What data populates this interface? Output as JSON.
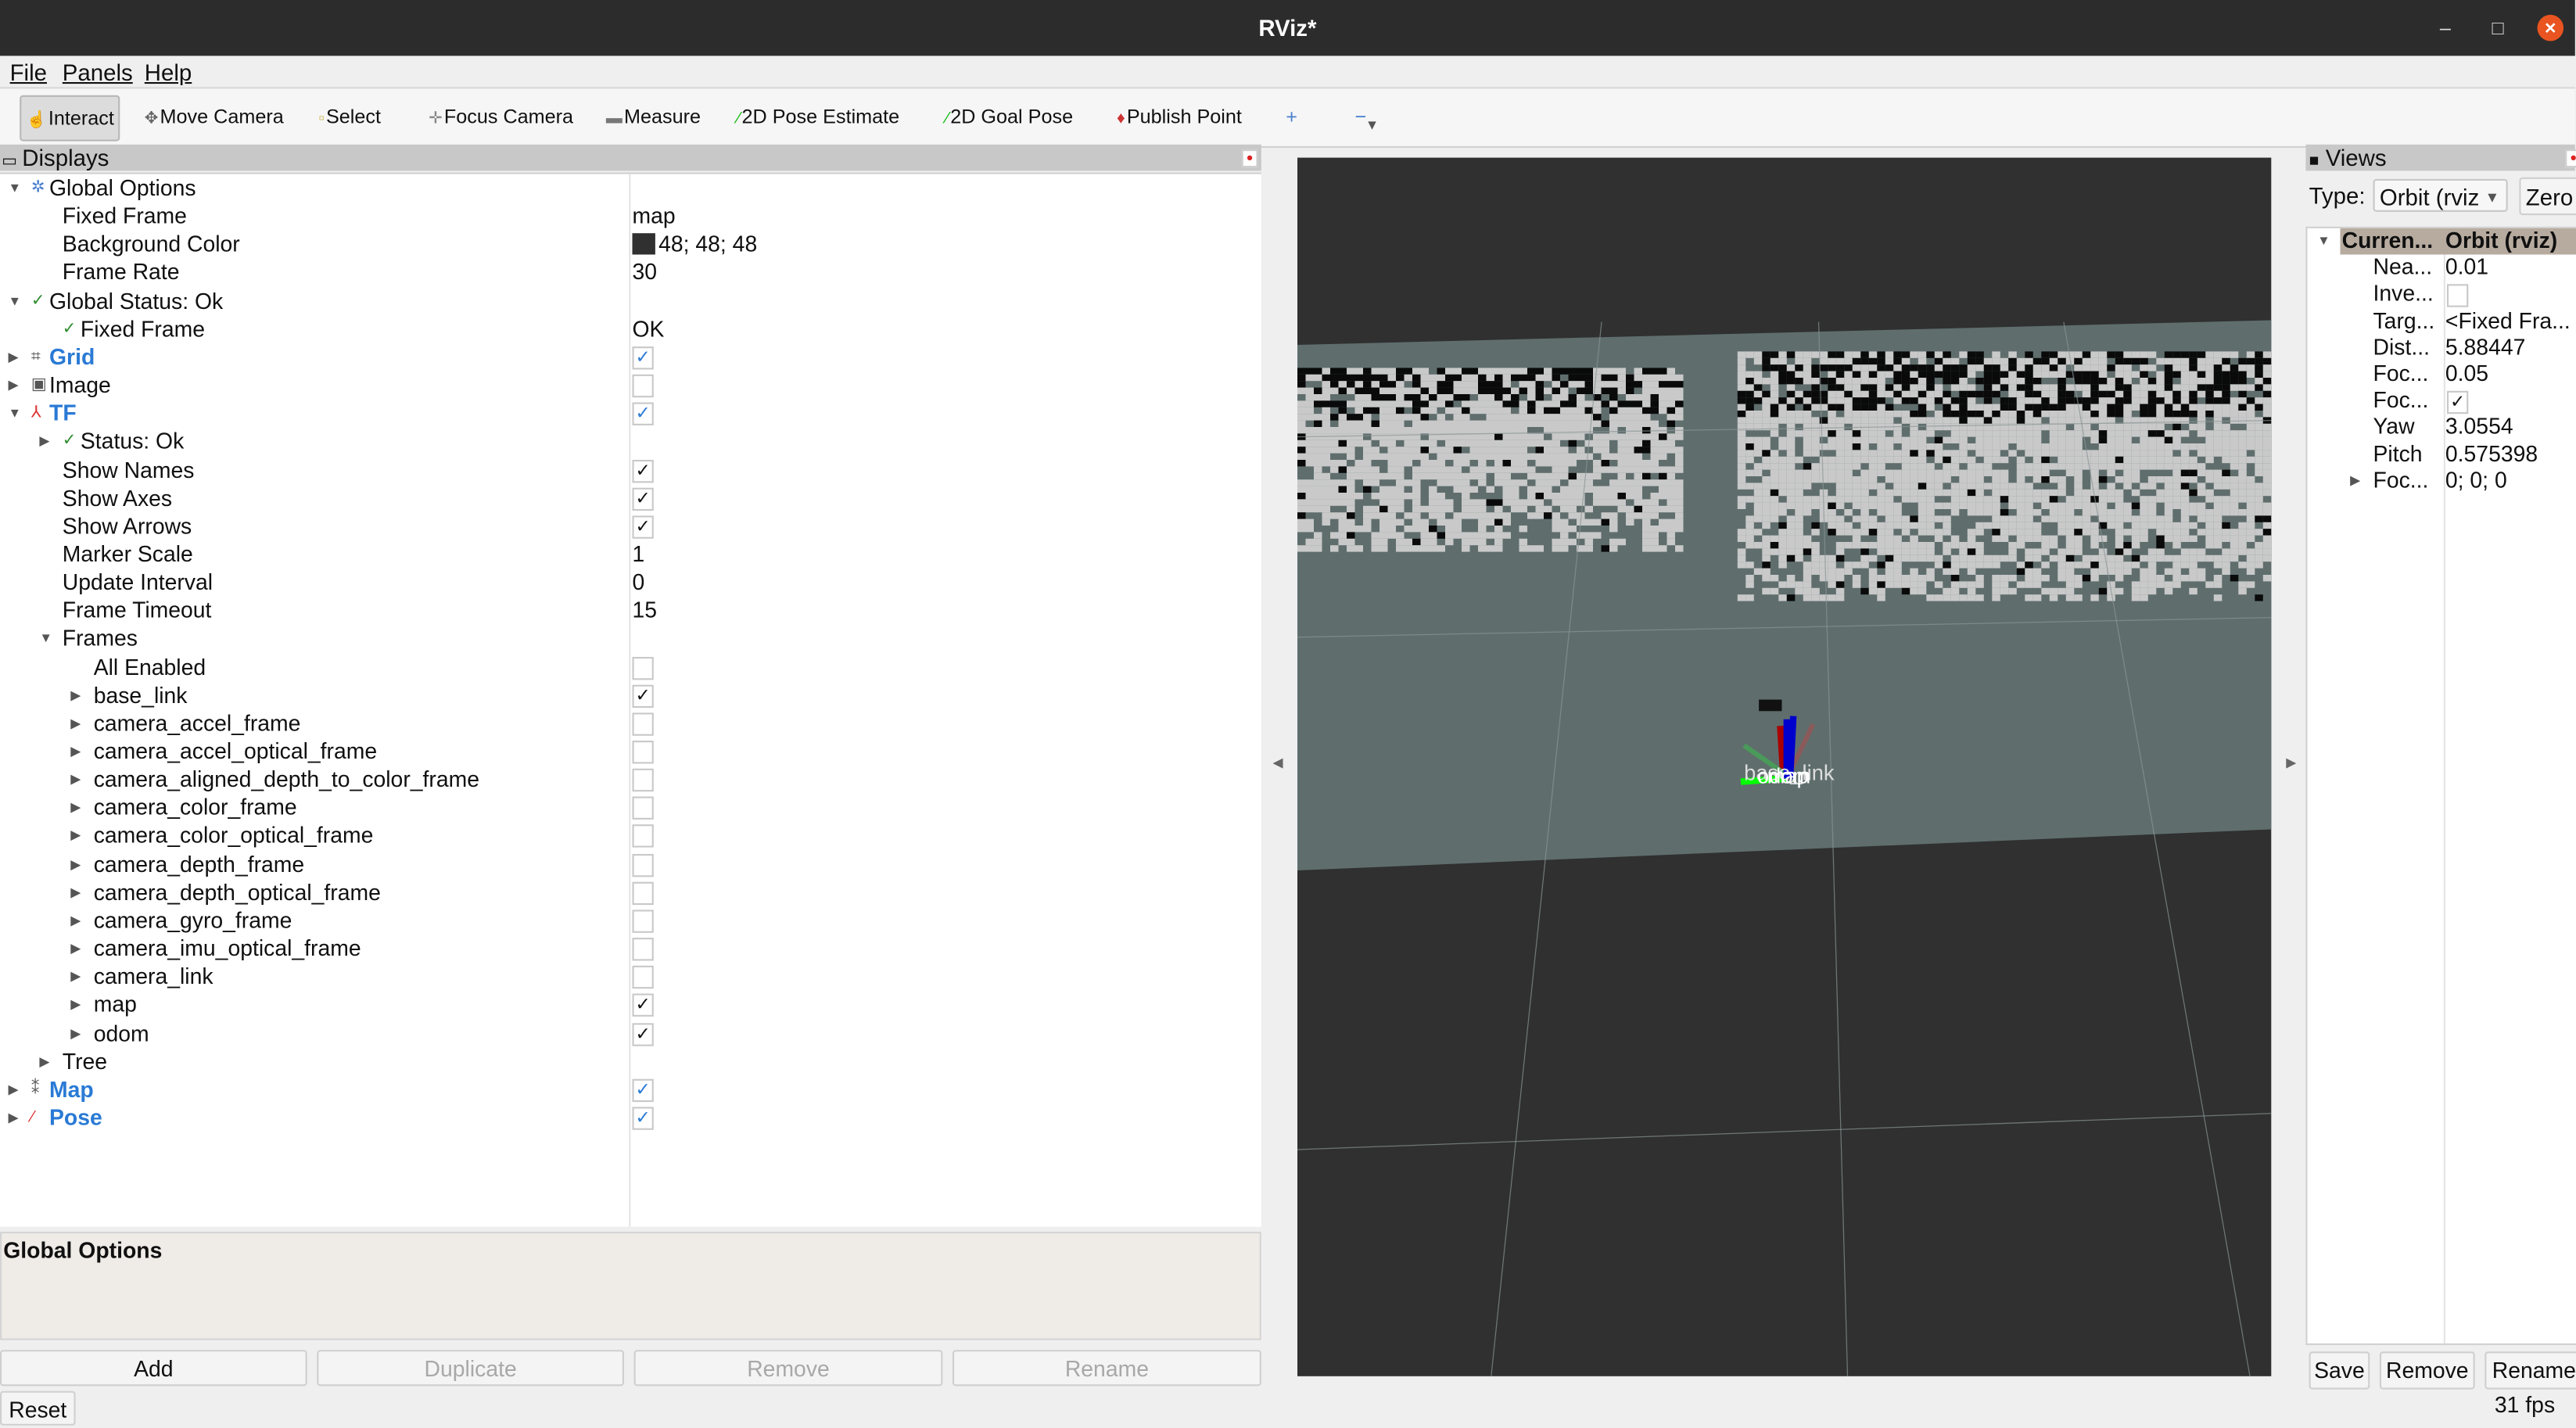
{
  "window": {
    "title": "RViz*",
    "minimize": "–",
    "maximize": "□",
    "close": "×"
  },
  "menu": [
    "File",
    "Panels",
    "Help"
  ],
  "toolbar": [
    {
      "label": "Interact",
      "icon": "hand-icon",
      "glyph": "☝",
      "pressed": true
    },
    {
      "label": "Move Camera",
      "icon": "move-camera-icon",
      "glyph": "✥"
    },
    {
      "label": "Select",
      "icon": "select-icon",
      "glyph": "▫"
    },
    {
      "label": "Focus Camera",
      "icon": "focus-camera-icon",
      "glyph": "✛"
    },
    {
      "label": "Measure",
      "icon": "ruler-icon",
      "glyph": "▬"
    },
    {
      "label": "2D Pose Estimate",
      "icon": "pose-estimate-icon",
      "glyph": "⁄"
    },
    {
      "label": "2D Goal Pose",
      "icon": "goal-pose-icon",
      "glyph": "⁄"
    },
    {
      "label": "Publish Point",
      "icon": "map-pin-icon",
      "glyph": "♦"
    }
  ],
  "toolbar_extra": {
    "add_tool": "+",
    "remove_tool": "−",
    "dropdown": "▾"
  },
  "displays": {
    "title": "Displays",
    "rows": [
      {
        "label": "Global Options",
        "level": 0,
        "expand": "open",
        "icon": "gear-icon",
        "glyph": "✲",
        "iconColor": "#4a7fd0"
      },
      {
        "label": "Fixed Frame",
        "level": 1,
        "value": "map"
      },
      {
        "label": "Background Color",
        "level": 1,
        "value": "48; 48; 48",
        "swatch": "#303030"
      },
      {
        "label": "Frame Rate",
        "level": 1,
        "value": "30"
      },
      {
        "label": "Global Status: Ok",
        "level": 0,
        "expand": "open",
        "icon": "check-icon",
        "glyph": "✓",
        "iconColor": "#2e8b2e"
      },
      {
        "label": "Fixed Frame",
        "level": 1,
        "icon": "check-icon",
        "glyph": "✓",
        "iconColor": "#2e8b2e",
        "value": "OK"
      },
      {
        "label": "Grid",
        "level": 0,
        "expand": "closed",
        "icon": "grid-icon",
        "glyph": "⌗",
        "display": true,
        "checked": true
      },
      {
        "label": "Image",
        "level": 0,
        "expand": "closed",
        "icon": "image-icon",
        "glyph": "▣",
        "checked": false
      },
      {
        "label": "TF",
        "level": 0,
        "expand": "open",
        "icon": "tf-axes-icon",
        "glyph": "⅄",
        "iconColor": "#d33",
        "display": true,
        "checked": true
      },
      {
        "label": "Status: Ok",
        "level": 1,
        "expand": "closed",
        "icon": "check-icon",
        "glyph": "✓",
        "iconColor": "#2e8b2e"
      },
      {
        "label": "Show Names",
        "level": 1,
        "checked": true
      },
      {
        "label": "Show Axes",
        "level": 1,
        "checked": true
      },
      {
        "label": "Show Arrows",
        "level": 1,
        "checked": true
      },
      {
        "label": "Marker Scale",
        "level": 1,
        "value": "1"
      },
      {
        "label": "Update Interval",
        "level": 1,
        "value": "0"
      },
      {
        "label": "Frame Timeout",
        "level": 1,
        "value": "15"
      },
      {
        "label": "Frames",
        "level": 1,
        "expand": "open"
      },
      {
        "label": "All Enabled",
        "level": 2,
        "checked": false
      },
      {
        "label": "base_link",
        "level": 2,
        "expand": "closed",
        "checked": true
      },
      {
        "label": "camera_accel_frame",
        "level": 2,
        "expand": "closed",
        "checked": false
      },
      {
        "label": "camera_accel_optical_frame",
        "level": 2,
        "expand": "closed",
        "checked": false
      },
      {
        "label": "camera_aligned_depth_to_color_frame",
        "level": 2,
        "expand": "closed",
        "checked": false
      },
      {
        "label": "camera_color_frame",
        "level": 2,
        "expand": "closed",
        "checked": false
      },
      {
        "label": "camera_color_optical_frame",
        "level": 2,
        "expand": "closed",
        "checked": false
      },
      {
        "label": "camera_depth_frame",
        "level": 2,
        "expand": "closed",
        "checked": false
      },
      {
        "label": "camera_depth_optical_frame",
        "level": 2,
        "expand": "closed",
        "checked": false
      },
      {
        "label": "camera_gyro_frame",
        "level": 2,
        "expand": "closed",
        "checked": false
      },
      {
        "label": "camera_imu_optical_frame",
        "level": 2,
        "expand": "closed",
        "checked": false
      },
      {
        "label": "camera_link",
        "level": 2,
        "expand": "closed",
        "checked": false
      },
      {
        "label": "map",
        "level": 2,
        "expand": "closed",
        "checked": true
      },
      {
        "label": "odom",
        "level": 2,
        "expand": "closed",
        "checked": true
      },
      {
        "label": "Tree",
        "level": 1,
        "expand": "closed"
      },
      {
        "label": "Map",
        "level": 0,
        "expand": "closed",
        "icon": "map-icon",
        "glyph": "⁑",
        "display": true,
        "checked": true
      },
      {
        "label": "Pose",
        "level": 0,
        "expand": "closed",
        "icon": "pose-arrow-icon",
        "glyph": "⁄",
        "iconColor": "#d33",
        "display": true,
        "checked": true
      }
    ],
    "description_title": "Global Options",
    "buttons": {
      "add": "Add",
      "duplicate": "Duplicate",
      "remove": "Remove",
      "rename": "Rename"
    },
    "reset": "Reset"
  },
  "viewport": {
    "frame_labels": [
      "base_link",
      "odom",
      "map"
    ],
    "background_color": "#303030",
    "plane_color": "#5f6e6d",
    "map_free_color": "#c9c9c9",
    "map_occupied_color": "#0a0a0a"
  },
  "views": {
    "title": "Views",
    "type_label": "Type:",
    "type_value": "Orbit (rviz",
    "zero": "Zero",
    "header": {
      "label": "Curren...",
      "value": "Orbit (rviz)"
    },
    "rows": [
      {
        "label": "Nea...",
        "value": "0.01"
      },
      {
        "label": "Inve...",
        "checked": false
      },
      {
        "label": "Targ...",
        "value": "<Fixed Fra..."
      },
      {
        "label": "Dist...",
        "value": "5.88447"
      },
      {
        "label": "Foc...",
        "value": "0.05"
      },
      {
        "label": "Foc...",
        "checked": true
      },
      {
        "label": "Yaw",
        "value": "3.0554"
      },
      {
        "label": "Pitch",
        "value": "0.575398"
      },
      {
        "label": "Foc...",
        "value": "0; 0; 0",
        "expand": "closed"
      }
    ],
    "buttons": {
      "save": "Save",
      "remove": "Remove",
      "rename": "Rename"
    }
  },
  "status": {
    "fps": "31 fps"
  }
}
